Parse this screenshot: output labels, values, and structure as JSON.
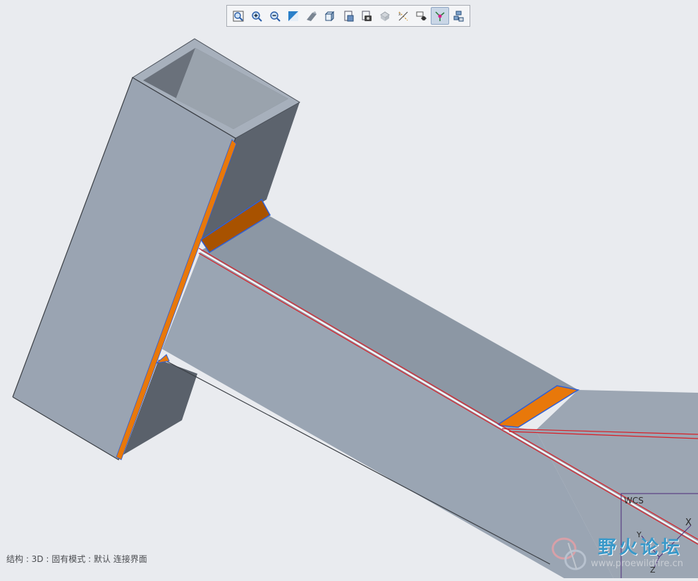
{
  "toolbar": {
    "buttons": [
      {
        "icon": "refit-icon",
        "active": false
      },
      {
        "icon": "zoom-in-icon",
        "active": false
      },
      {
        "icon": "zoom-out-icon",
        "active": false
      },
      {
        "icon": "repaint-icon",
        "active": false
      },
      {
        "icon": "perspective-icon",
        "active": false
      },
      {
        "icon": "display-style-icon",
        "active": false
      },
      {
        "icon": "saved-views-icon",
        "active": false
      },
      {
        "icon": "view-manager-icon",
        "active": false
      },
      {
        "icon": "section-icon",
        "active": false
      },
      {
        "icon": "datum-display-icon",
        "active": false
      },
      {
        "icon": "annotation-display-icon",
        "active": false
      },
      {
        "icon": "spin-center-icon",
        "active": true
      },
      {
        "icon": "layer-icon",
        "active": false
      }
    ]
  },
  "viewport": {
    "csys_label": "WCS",
    "axis_x": "X",
    "axis_y": "Y",
    "axis_z": "Z",
    "colors": {
      "background": "#e9ebef",
      "tube_light": "#9aa4b2",
      "tube_dark": "#5c636d",
      "highlight_orange": "#e8780a",
      "edge_blue": "#2f5fd6",
      "datum_red": "#d81f26",
      "csys_purple": "#4b2a7a"
    }
  },
  "status": {
    "text": "结构 : 3D : 固有模式 : 默认 连接界面"
  },
  "watermark": {
    "title": "野火论坛",
    "url": "www.proewildfire.cn"
  }
}
